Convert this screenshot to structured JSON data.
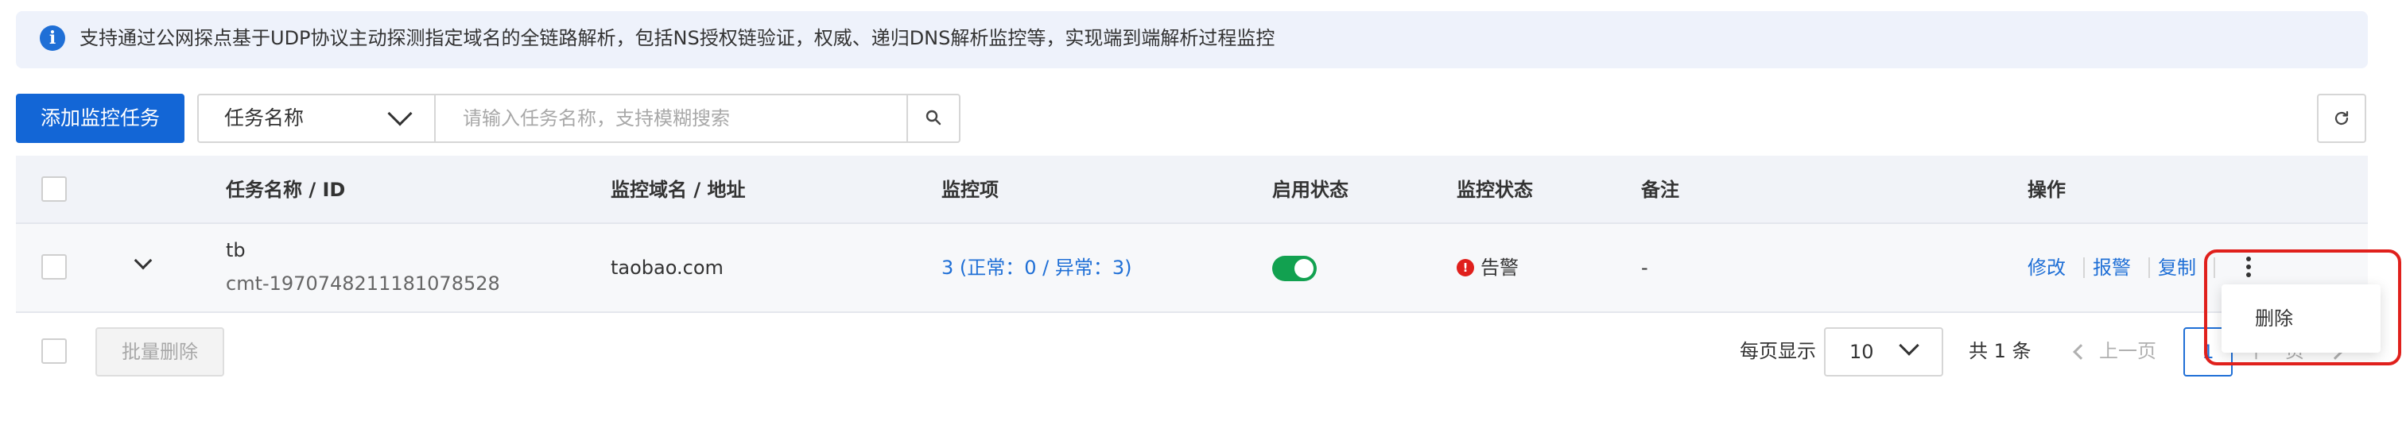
{
  "banner": {
    "text": "支持通过公网探点基于UDP协议主动探测指定域名的全链路解析，包括NS授权链验证，权威、递归DNS解析监控等，实现端到端解析过程监控"
  },
  "toolbar": {
    "add_task_label": "添加监控任务",
    "filter_field": "任务名称",
    "search_placeholder": "请输入任务名称，支持模糊搜索"
  },
  "table": {
    "columns": [
      "任务名称 / ID",
      "监控域名 / 地址",
      "监控项",
      "启用状态",
      "监控状态",
      "备注",
      "操作"
    ],
    "rows": [
      {
        "name": "tb",
        "id": "cmt-1970748211181078528",
        "domain": "taobao.com",
        "items": "3 (正常：0 / 异常：3)",
        "enabled": true,
        "status": "告警",
        "remark": "-",
        "actions": [
          "修改",
          "报警",
          "复制"
        ],
        "menu": [
          "删除"
        ]
      }
    ]
  },
  "footer": {
    "batch_delete_label": "批量删除",
    "per_page_label": "每页显示",
    "page_size": "10",
    "total": "共 1 条",
    "prev_label": "上一页",
    "current_page": "1",
    "next_label": "下一页"
  },
  "colors": {
    "primary": "#1366d6",
    "link": "#1f6fd6",
    "toggle_on": "#12a150",
    "alert": "#e0201c",
    "banner_bg": "#eef2fb"
  },
  "icons": [
    "info-icon",
    "chevron-down-icon",
    "search-icon",
    "refresh-icon",
    "expand-chevron-icon",
    "alert-icon",
    "more-icon",
    "chevron-left-icon",
    "chevron-right-icon"
  ]
}
